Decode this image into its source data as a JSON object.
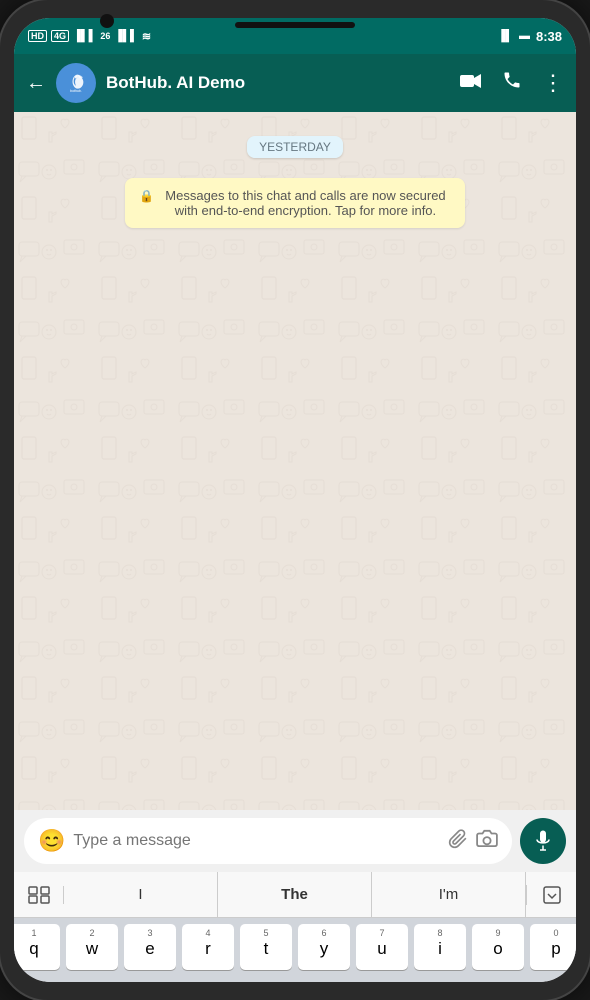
{
  "statusBar": {
    "leftIcons": "HD  4G  26  ⫻",
    "time": "8:38",
    "rightIcons": "▐▐  🔋"
  },
  "header": {
    "backLabel": "←",
    "contactName": "BotHub. AI Demo",
    "videoCallIcon": "video-camera",
    "callIcon": "phone",
    "menuIcon": "more-vertical"
  },
  "chat": {
    "dateBadge": "YESTERDAY",
    "encryptionNotice": "Messages to this chat and calls are now secured with end-to-end encryption. Tap for more info."
  },
  "inputBar": {
    "placeholder": "Type a message",
    "emojiIcon": "😊",
    "attachIcon": "📎",
    "cameraIcon": "📷",
    "micIcon": "🎤"
  },
  "keyboard": {
    "suggestions": {
      "left": "⊞",
      "words": [
        "I",
        "The",
        "I'm"
      ],
      "right": "⌄"
    },
    "rows": [
      [
        {
          "num": "1",
          "letter": "q"
        },
        {
          "num": "2",
          "letter": "w"
        },
        {
          "num": "3",
          "letter": "e"
        },
        {
          "num": "4",
          "letter": "r"
        },
        {
          "num": "5",
          "letter": "t"
        },
        {
          "num": "6",
          "letter": "y"
        },
        {
          "num": "7",
          "letter": "u"
        },
        {
          "num": "8",
          "letter": "i"
        },
        {
          "num": "9",
          "letter": "o"
        },
        {
          "num": "0",
          "letter": "p"
        }
      ]
    ]
  }
}
